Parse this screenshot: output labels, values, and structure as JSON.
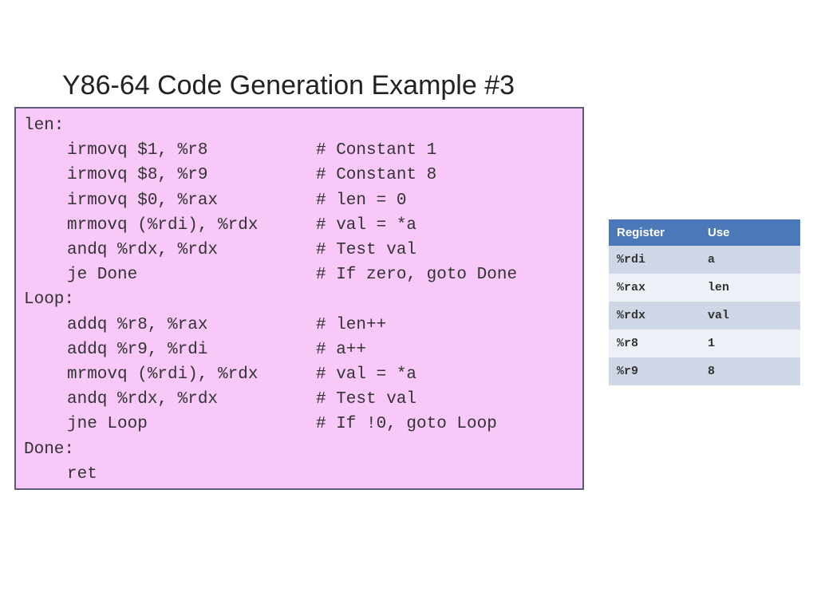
{
  "title": "Y86-64 Code Generation Example #3",
  "code": {
    "lines": [
      {
        "type": "label",
        "text": "len:"
      },
      {
        "type": "instr",
        "instr": "irmovq $1, %r8",
        "comment": "# Constant 1"
      },
      {
        "type": "instr",
        "instr": "irmovq $8, %r9",
        "comment": "# Constant 8"
      },
      {
        "type": "instr",
        "instr": "irmovq $0, %rax",
        "comment": "# len = 0"
      },
      {
        "type": "instr",
        "instr": "mrmovq (%rdi), %rdx",
        "comment": "# val = *a"
      },
      {
        "type": "instr",
        "instr": "andq %rdx, %rdx",
        "comment": "# Test val"
      },
      {
        "type": "instr",
        "instr": "je Done",
        "comment": "# If zero, goto Done"
      },
      {
        "type": "label",
        "text": "Loop:"
      },
      {
        "type": "instr",
        "instr": "addq %r8, %rax",
        "comment": "# len++"
      },
      {
        "type": "instr",
        "instr": "addq %r9, %rdi",
        "comment": "# a++"
      },
      {
        "type": "instr",
        "instr": "mrmovq (%rdi), %rdx",
        "comment": "# val = *a"
      },
      {
        "type": "instr",
        "instr": "andq %rdx, %rdx",
        "comment": "# Test val"
      },
      {
        "type": "instr",
        "instr": "jne Loop",
        "comment": "# If !0, goto Loop"
      },
      {
        "type": "label",
        "text": "Done:"
      },
      {
        "type": "instr",
        "instr": "ret",
        "comment": ""
      }
    ]
  },
  "table": {
    "headers": [
      "Register",
      "Use"
    ],
    "rows": [
      [
        "%rdi",
        "a"
      ],
      [
        "%rax",
        "len"
      ],
      [
        "%rdx",
        "val"
      ],
      [
        "%r8",
        "1"
      ],
      [
        "%r9",
        "8"
      ]
    ]
  }
}
